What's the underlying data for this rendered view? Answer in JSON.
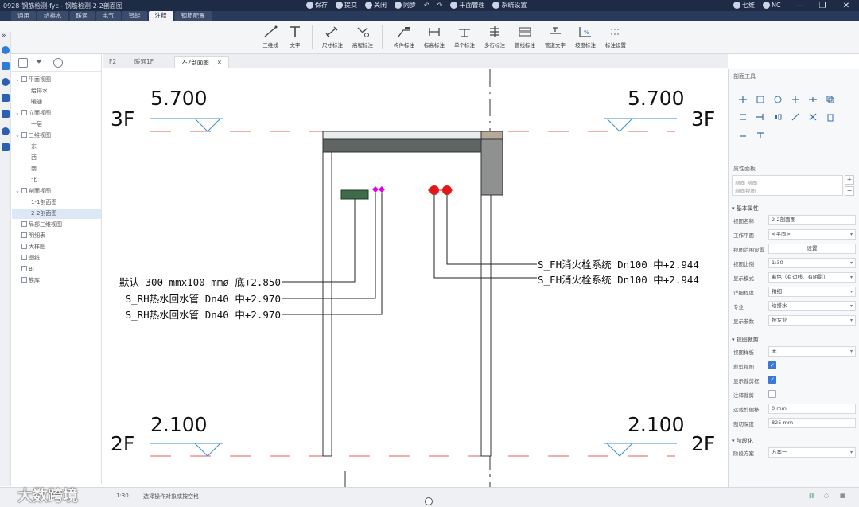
{
  "app": {
    "title": "0928-钢筋检测-fyc - 钢筋检测-2-2剖面图",
    "toolbar": [
      {
        "label": "保存",
        "icon": "save-icon"
      },
      {
        "label": "提交",
        "icon": "submit-icon"
      },
      {
        "label": "关闭",
        "icon": "close-doc-icon"
      },
      {
        "label": "同步",
        "icon": "sync-icon"
      }
    ],
    "plugin_label": "平面管理",
    "settings_label": "系统设置",
    "user_1": "七维",
    "user_2": "NC"
  },
  "menu_tabs": [
    "通用",
    "给排水",
    "暖通",
    "电气",
    "智能",
    "注释",
    "钢筋配置"
  ],
  "active_menu_tab_index": 5,
  "ribbon": {
    "buttons": [
      {
        "label": "三维线",
        "icon": "line-3d-icon"
      },
      {
        "label": "文字",
        "icon": "text-icon"
      },
      {
        "label": "尺寸标注",
        "icon": "dimension-icon"
      },
      {
        "label": "高程标注",
        "icon": "elevation-icon"
      },
      {
        "label": "构件标注",
        "icon": "component-tag-icon"
      },
      {
        "label": "标高标注",
        "icon": "level-tag-icon"
      },
      {
        "label": "单个标注",
        "icon": "single-tag-icon"
      },
      {
        "label": "多行标注",
        "icon": "multi-tag-icon"
      },
      {
        "label": "管线标注",
        "icon": "pipe-tag-icon"
      },
      {
        "label": "管道文字",
        "icon": "pipe-text-icon"
      },
      {
        "label": "坡度标注",
        "icon": "slope-tag-icon"
      },
      {
        "label": "标注设置",
        "icon": "tag-settings-icon"
      }
    ]
  },
  "tree": {
    "items": [
      {
        "label": "平面视图",
        "level": 0,
        "expanded": true
      },
      {
        "label": "给排水",
        "level": 1
      },
      {
        "label": "暖通",
        "level": 1
      },
      {
        "label": "立面视图",
        "level": 0,
        "expanded": true
      },
      {
        "label": "一层",
        "level": 1
      },
      {
        "label": "三维视图",
        "level": 0,
        "expanded": true
      },
      {
        "label": "东",
        "level": 1
      },
      {
        "label": "西",
        "level": 1
      },
      {
        "label": "南",
        "level": 1
      },
      {
        "label": "北",
        "level": 1
      },
      {
        "label": "剖面视图",
        "level": 0,
        "expanded": true
      },
      {
        "label": "1-1剖面图",
        "level": 1
      },
      {
        "label": "2-2剖面图",
        "level": 1,
        "selected": true
      },
      {
        "label": "局部三维视图",
        "level": 0
      },
      {
        "label": "明细表",
        "level": 0
      },
      {
        "label": "大样图",
        "level": 0
      },
      {
        "label": "图纸",
        "level": 0
      },
      {
        "label": "BI",
        "level": 0
      },
      {
        "label": "族库",
        "level": 0
      }
    ]
  },
  "doc_tabs": [
    {
      "label": "F2"
    },
    {
      "label": "暖通1F"
    },
    {
      "label": "2-2剖面图",
      "active": true
    }
  ],
  "drawing": {
    "levels": [
      {
        "floor": "3F",
        "elevation": "5.700"
      },
      {
        "floor": "2F",
        "elevation": "2.100"
      }
    ],
    "labels_left": [
      "默认 300 mmx100 mmø 底+2.850",
      "S_RH热水回水管 Dn40 中+2.970",
      "S_RH热水回水管 Dn40 中+2.970"
    ],
    "labels_right": [
      "S_FH消火栓系统 Dn100 中+2.944",
      "S_FH消火栓系统 Dn100 中+2.944"
    ]
  },
  "right_panel": {
    "tools_title": "剖面工具",
    "props_title": "属性面板",
    "type_value": "剖面 剖面\n剖面视图",
    "section_basic": "基本属性",
    "props": [
      {
        "label": "视图名称",
        "value": "2-2剖面图",
        "kind": "text"
      },
      {
        "label": "工作平面",
        "value": "<平面>",
        "kind": "select"
      },
      {
        "label": "视图范围设置",
        "value": "设置",
        "kind": "button"
      },
      {
        "label": "视图比例",
        "value": "1:30",
        "kind": "select"
      },
      {
        "label": "显示模式",
        "value": "着色（有边线、有阴影）",
        "kind": "select"
      },
      {
        "label": "详细程度",
        "value": "精细",
        "kind": "select"
      },
      {
        "label": "专业",
        "value": "给排水",
        "kind": "select"
      },
      {
        "label": "显示参数",
        "value": "按专业",
        "kind": "select"
      }
    ],
    "section_crop": "视图裁剪",
    "crop_props": [
      {
        "label": "视图样板",
        "value": "无",
        "kind": "select"
      },
      {
        "label": "裁剪视图",
        "checked": true,
        "kind": "check"
      },
      {
        "label": "显示裁剪框",
        "checked": true,
        "kind": "check"
      },
      {
        "label": "注释裁剪",
        "checked": false,
        "kind": "check"
      },
      {
        "label": "远裁剪偏移",
        "value": "0 mm",
        "kind": "text"
      },
      {
        "label": "剖切深度",
        "value": "825 mm",
        "kind": "text"
      }
    ],
    "section_phase": "阶段化",
    "phase_props": [
      {
        "label": "阶段方案",
        "value": "方案一",
        "kind": "select"
      }
    ]
  },
  "statusbar": {
    "scale": "1:30",
    "hint": "选择操作对象或按空格"
  },
  "watermark": "大数跨境",
  "colors": {
    "titlebar": "#1e2b45",
    "level_line": "#e06060",
    "tag_blue": "#3a8fd6",
    "fire_red": "#e21818",
    "magenta": "#e000e0",
    "green_duct": "#3f6b4a"
  }
}
